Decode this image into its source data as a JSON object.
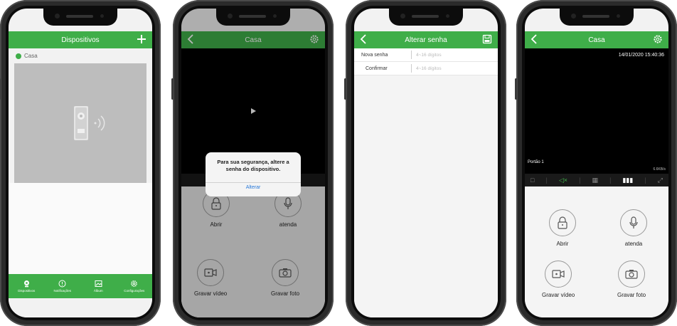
{
  "phone1": {
    "title": "Dispositivos",
    "add_icon": "plus-icon",
    "device_label": "Casa",
    "device_status_color": "#3fae49",
    "tabs": [
      {
        "label": "Dispositivos",
        "icon": "camera-icon"
      },
      {
        "label": "Notificações",
        "icon": "alert-icon"
      },
      {
        "label": "Álbum",
        "icon": "image-icon"
      },
      {
        "label": "Configurações",
        "icon": "gear-icon"
      }
    ]
  },
  "phone2": {
    "title": "Casa",
    "dialog_message": "Para sua segurança, altere a senha do dispositivo.",
    "dialog_action": "Alterar",
    "open_label": "Abrir",
    "answer_label": "atenda",
    "record_label": "Gravar vídeo",
    "photo_label": "Gravar foto"
  },
  "phone3": {
    "title": "Alterar senha",
    "new_password_label": "Nova senha",
    "new_password_placeholder": "4~16 dígitos",
    "confirm_label": "Confirmar",
    "confirm_placeholder": "4~16 dígitos"
  },
  "phone4": {
    "title": "Casa",
    "timestamp": "14/01/2020 15:40:36",
    "camera_name": "Portão 1",
    "bitrate": "6.6KB/s",
    "open_label": "Abrir",
    "answer_label": "atenda",
    "record_label": "Gravar vídeo",
    "photo_label": "Gravar foto"
  },
  "colors": {
    "accent": "#3fae49",
    "link": "#2a7ad9",
    "frame": "#2b2b2b"
  }
}
